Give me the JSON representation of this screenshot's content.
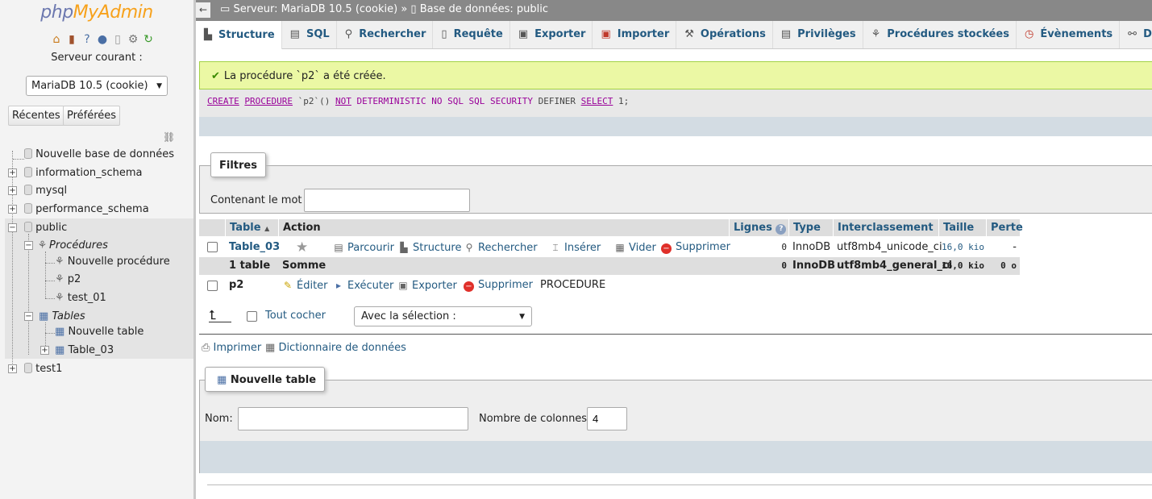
{
  "nav": {
    "logo_php": "php",
    "logo_myadmin": "MyAdmin",
    "server_label": "Serveur courant :",
    "server_select_value": "MariaDB 10.5 (cookie)",
    "recent_label": "Récentes",
    "favorites_label": "Préférées",
    "tree": {
      "new_db": "Nouvelle base de données",
      "information_schema": "information_schema",
      "mysql": "mysql",
      "performance_schema": "performance_schema",
      "public": "public",
      "procedures": "Procédures",
      "new_procedure": "Nouvelle procédure",
      "p2": "p2",
      "test_01": "test_01",
      "tables": "Tables",
      "new_table": "Nouvelle table",
      "table_03": "Table_03",
      "test1": "test1"
    }
  },
  "topbar": {
    "back": "←",
    "server": "Serveur: MariaDB 10.5 (cookie)",
    "separator": "»",
    "database": "Base de données: public"
  },
  "tabs": [
    {
      "label": "Structure",
      "icon": "structure-icon"
    },
    {
      "label": "SQL",
      "icon": "sql-icon"
    },
    {
      "label": "Rechercher",
      "icon": "search-icon"
    },
    {
      "label": "Requête",
      "icon": "query-icon"
    },
    {
      "label": "Exporter",
      "icon": "export-icon"
    },
    {
      "label": "Importer",
      "icon": "import-icon"
    },
    {
      "label": "Opérations",
      "icon": "wrench-icon"
    },
    {
      "label": "Privilèges",
      "icon": "privileges-icon"
    },
    {
      "label": "Procédures stockées",
      "icon": "routines-icon"
    },
    {
      "label": "Évènements",
      "icon": "clock-icon"
    },
    {
      "label": "Dé",
      "icon": "triggers-icon"
    }
  ],
  "message": {
    "text": "La procédure `p2` a été créée."
  },
  "sql": {
    "create": "CREATE",
    "procedure": "PROCEDURE",
    "name": "`p2`()",
    "not": "NOT",
    "rest": "DETERMINISTIC NO SQL SQL SECURITY",
    "definer": "DEFINER",
    "select": "SELECT",
    "end": "1;"
  },
  "filters": {
    "legend": "Filtres",
    "contains_label": "Contenant le mot :",
    "contains_value": ""
  },
  "table": {
    "headers": {
      "table": "Table",
      "action": "Action",
      "rows": "Lignes",
      "type": "Type",
      "collation": "Interclassement",
      "size": "Taille",
      "overhead": "Perte"
    },
    "row": {
      "name": "Table_03",
      "browse": "Parcourir",
      "structure": "Structure",
      "search": "Rechercher",
      "insert": "Insérer",
      "empty": "Vider",
      "drop": "Supprimer",
      "rows": "0",
      "type": "InnoDB",
      "collation": "utf8mb4_unicode_ci",
      "size": "16,0 kio",
      "overhead": "-"
    },
    "summary": {
      "count": "1 table",
      "label": "Somme",
      "rows": "0",
      "type": "InnoDB",
      "collation": "utf8mb4_general_ci",
      "size": "16,0 kio",
      "overhead": "0 o"
    },
    "routine": {
      "name": "p2",
      "edit": "Éditer",
      "execute": "Exécuter",
      "export": "Exporter",
      "drop": "Supprimer",
      "type": "PROCEDURE"
    }
  },
  "bulk": {
    "check_all": "Tout cocher",
    "with_selected": "Avec la sélection :"
  },
  "links": {
    "print": "Imprimer",
    "dictionary": "Dictionnaire de données"
  },
  "new_table": {
    "legend": "Nouvelle table",
    "name_label": "Nom:",
    "name_value": "",
    "columns_label": "Nombre de colonnes:",
    "columns_value": "4"
  }
}
